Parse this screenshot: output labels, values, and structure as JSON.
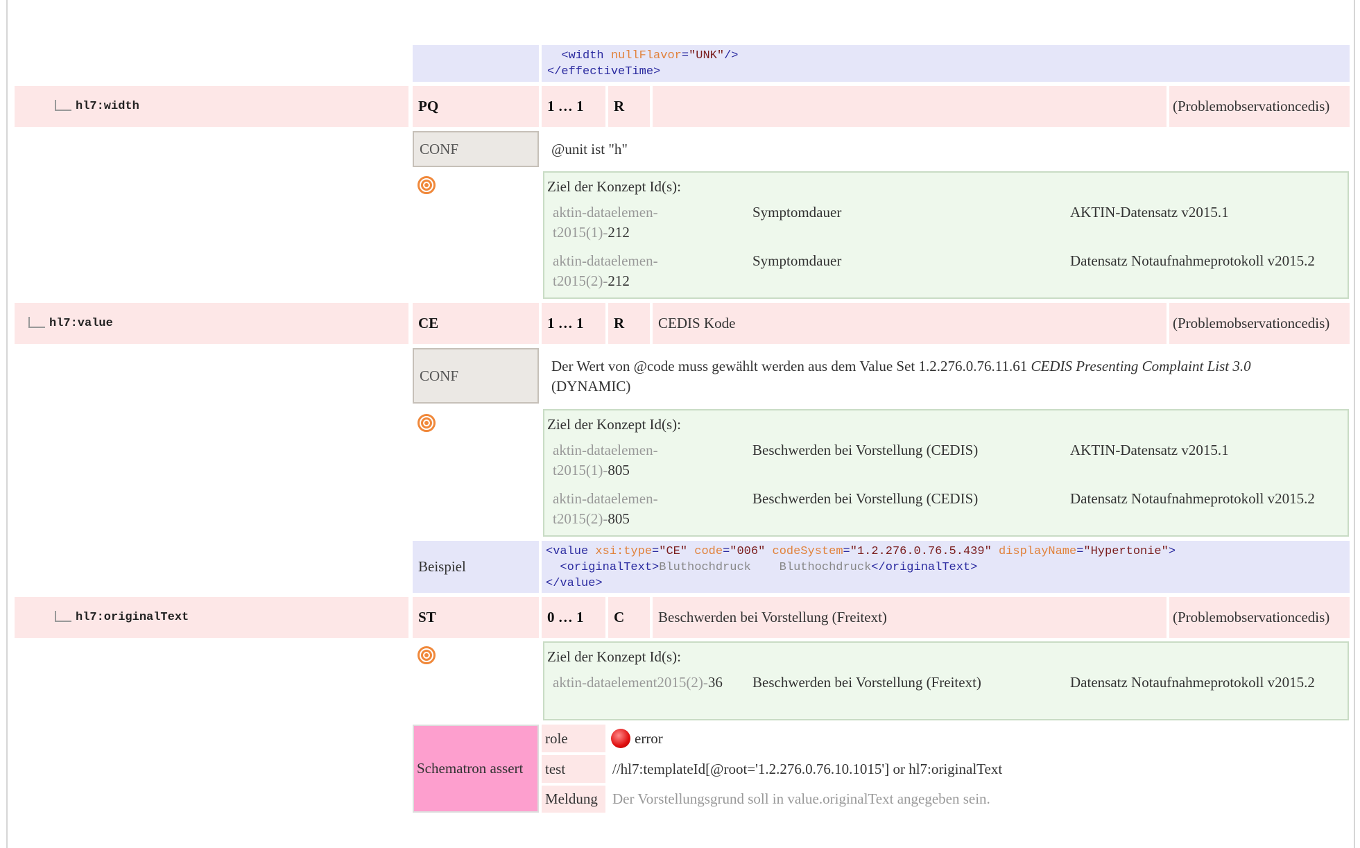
{
  "top_code": {
    "line1_tag": "<width ",
    "line1_attr": "nullFlavor",
    "line1_eq": "=",
    "line1_val": "\"UNK\"",
    "line1_end": "/>",
    "line2": "</effectiveTime>"
  },
  "rows": {
    "width": {
      "name": "hl7:width",
      "type": "PQ",
      "card": "1 … 1",
      "conf": "R",
      "desc": "",
      "source": "(Problemobservationcedis)"
    },
    "value": {
      "name": "hl7:value",
      "type": "CE",
      "card": "1 … 1",
      "conf": "R",
      "desc": "CEDIS Kode",
      "source": "(Problemobservationcedis)"
    },
    "originalText": {
      "name": "hl7:originalText",
      "type": "ST",
      "card": "0 … 1",
      "conf": "C",
      "desc": "Beschwerden bei Vorstellung (Freitext)",
      "source": "(Problemobservationcedis)"
    }
  },
  "width_conf": {
    "label": "CONF",
    "text": "@unit ist \"h\""
  },
  "width_concepts": {
    "heading": "Ziel der Konzept Id(s):",
    "items": [
      {
        "id_prefix": "aktin-dataelemen-",
        "id_line2_prefix": "t2015(1)-",
        "id_num": "212",
        "name": "Symptomdauer",
        "dataset": "AKTIN-Datensatz v2015.1"
      },
      {
        "id_prefix": "aktin-dataelemen-",
        "id_line2_prefix": "t2015(2)-",
        "id_num": "212",
        "name": "Symptomdauer",
        "dataset": "Datensatz Notaufnahmeprotokoll v2015.2"
      }
    ]
  },
  "value_conf": {
    "label": "CONF",
    "text_before": "Der Wert von @code muss gewählt werden aus dem Value Set 1.2.276.0.76.11.61 ",
    "text_italic": "CEDIS Presenting Complaint List 3.0",
    "text_after": " (DYNAMIC)"
  },
  "value_concepts": {
    "heading": "Ziel der Konzept Id(s):",
    "items": [
      {
        "id_prefix": "aktin-dataelemen-",
        "id_line2_prefix": "t2015(1)-",
        "id_num": "805",
        "name": "Beschwerden bei Vorstellung (CEDIS)",
        "dataset": "AKTIN-Datensatz v2015.1"
      },
      {
        "id_prefix": "aktin-dataelemen-",
        "id_line2_prefix": "t2015(2)-",
        "id_num": "805",
        "name": "Beschwerden bei Vorstellung (CEDIS)",
        "dataset": "Datensatz Notaufnahmeprotokoll v2015.2"
      }
    ]
  },
  "example": {
    "label": "Beispiel",
    "l1_tag": "<value ",
    "l1_a1": "xsi:type",
    "l1_v1": "\"CE\"",
    "l1_a2": "code",
    "l1_v2": "\"006\"",
    "l1_a3": "codeSystem",
    "l1_v3": "\"1.2.276.0.76.5.439\"",
    "l1_a4": "displayName",
    "l1_v4": "\"Hypertonie\"",
    "l1_end": ">",
    "l2_open": "<originalText>",
    "l2_text": "Bluthochdruck    Bluthochdruck",
    "l2_close": "</originalText>",
    "l3": "</value>"
  },
  "ot_concepts": {
    "heading": "Ziel der Konzept Id(s):",
    "item": {
      "id_prefix": "aktin-dataelement2015(2)-",
      "id_num": "36",
      "name": "Beschwerden bei Vorstellung (Freitext)",
      "dataset": "Datensatz Notaufnahmeprotokoll v2015.2"
    }
  },
  "schematron": {
    "label": "Schematron assert",
    "role_label": "role",
    "role_value": "error",
    "test_label": "test",
    "test_value": "//hl7:templateId[@root='1.2.276.0.76.10.1015'] or hl7:originalText",
    "msg_label": "Meldung",
    "msg_value": "Der Vorstellungsgrund soll in value.originalText angegeben sein."
  }
}
